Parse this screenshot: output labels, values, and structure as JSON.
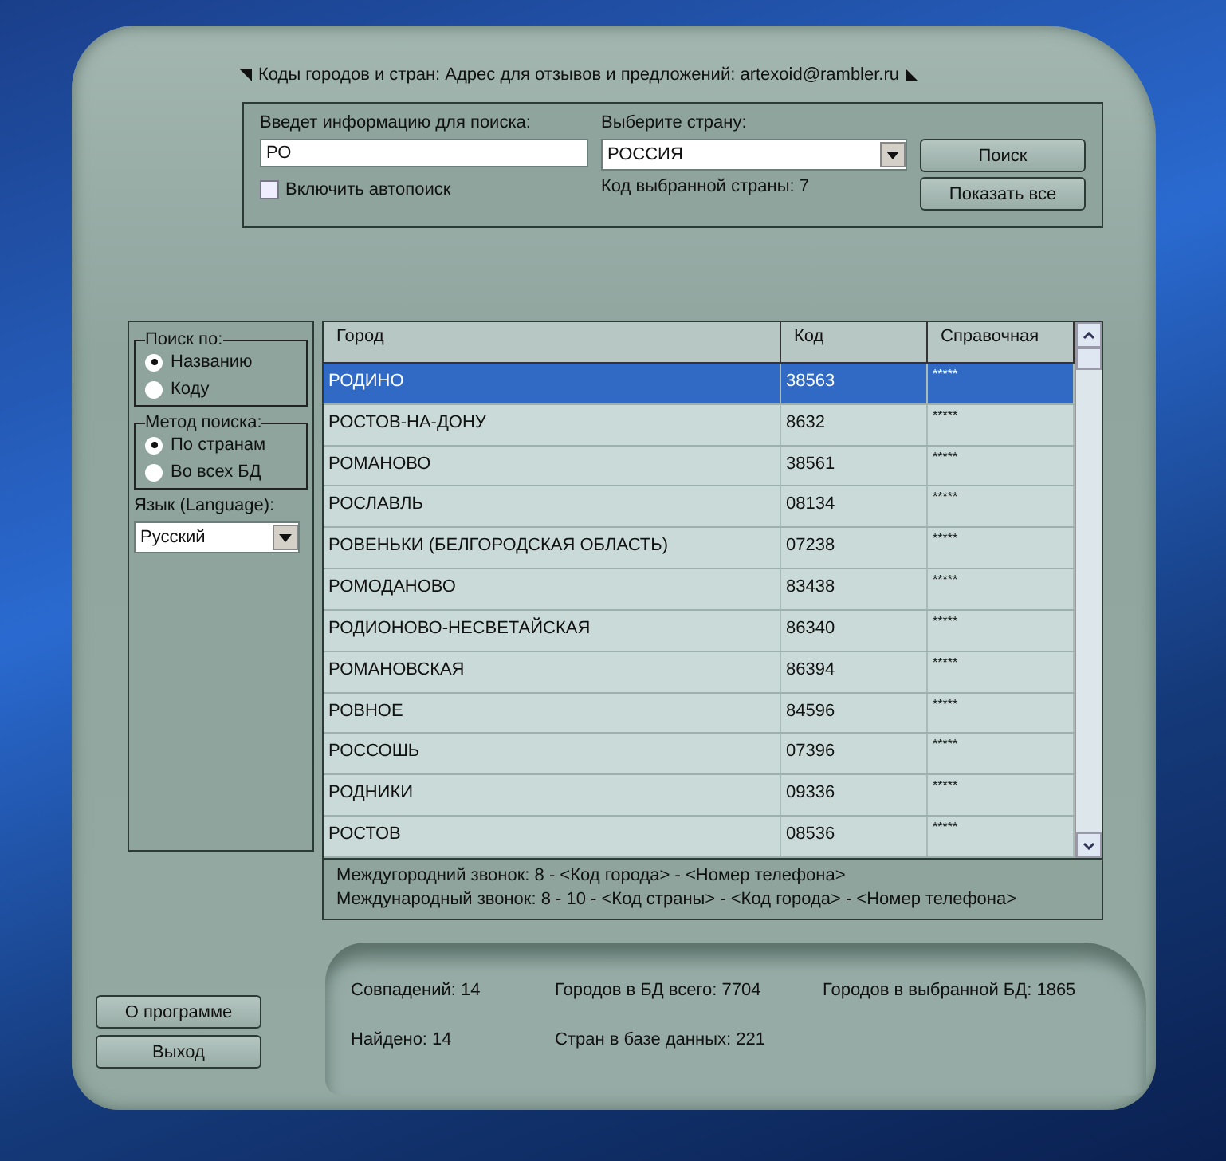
{
  "window": {
    "title": "Коды городов и стран: Адрес для отзывов и предложений: artexoid@rambler.ru"
  },
  "search": {
    "label": "Введет информацию для поиска:",
    "value": "РО",
    "autosearch": {
      "label": "Включить автопоиск",
      "checked": false
    }
  },
  "country": {
    "label": "Выберите страну:",
    "value": "РОССИЯ",
    "code_text": "Код выбранной страны: 7"
  },
  "buttons": {
    "search": "Поиск",
    "show_all": "Показать все"
  },
  "search_by": {
    "title": "Поиск по:",
    "options": [
      {
        "label": "Названию",
        "selected": true
      },
      {
        "label": "Коду",
        "selected": false
      }
    ]
  },
  "method": {
    "title": "Метод поиска:",
    "options": [
      {
        "label": "По странам",
        "selected": true
      },
      {
        "label": "Во всех БД",
        "selected": false
      }
    ]
  },
  "language": {
    "label": "Язык (Language):",
    "value": "Русский"
  },
  "table": {
    "columns": [
      "Город",
      "Код",
      "Справочная"
    ],
    "rows": [
      {
        "city": "РОДИНО",
        "code": "38563",
        "info": "*****",
        "selected": true
      },
      {
        "city": "РОСТОВ-НА-ДОНУ",
        "code": "8632",
        "info": "*****",
        "selected": false
      },
      {
        "city": "РОМАНОВО",
        "code": "38561",
        "info": "*****",
        "selected": false
      },
      {
        "city": "РОСЛАВЛЬ",
        "code": "08134",
        "info": "*****",
        "selected": false
      },
      {
        "city": "РОВЕНЬКИ (БЕЛГОРОДСКАЯ ОБЛАСТЬ)",
        "code": "07238",
        "info": "*****",
        "selected": false
      },
      {
        "city": "РОМОДАНОВО",
        "code": "83438",
        "info": "*****",
        "selected": false
      },
      {
        "city": "РОДИОНОВО-НЕСВЕТАЙСКАЯ",
        "code": "86340",
        "info": "*****",
        "selected": false
      },
      {
        "city": "РОМАНОВСКАЯ",
        "code": "86394",
        "info": "*****",
        "selected": false
      },
      {
        "city": "РОВНОЕ",
        "code": "84596",
        "info": "*****",
        "selected": false
      },
      {
        "city": "РОССОШЬ",
        "code": "07396",
        "info": "*****",
        "selected": false
      },
      {
        "city": "РОДНИКИ",
        "code": "09336",
        "info": "*****",
        "selected": false
      },
      {
        "city": "РОСТОВ",
        "code": "08536",
        "info": "*****",
        "selected": false
      }
    ]
  },
  "hints": [
    "Междугородний звонок: 8 - <Код города> - <Номер телефона>",
    "Международный звонок: 8 - 10 - <Код страны> - <Код города> - <Номер телефона>"
  ],
  "side_buttons": [
    "О программе",
    "Выход"
  ],
  "stats": [
    "Совпадений: 14",
    "Городов в БД всего: 7704",
    "Городов в выбранной БД:  1865",
    "Найдено: 14",
    "Стран в базе данных: 221"
  ]
}
